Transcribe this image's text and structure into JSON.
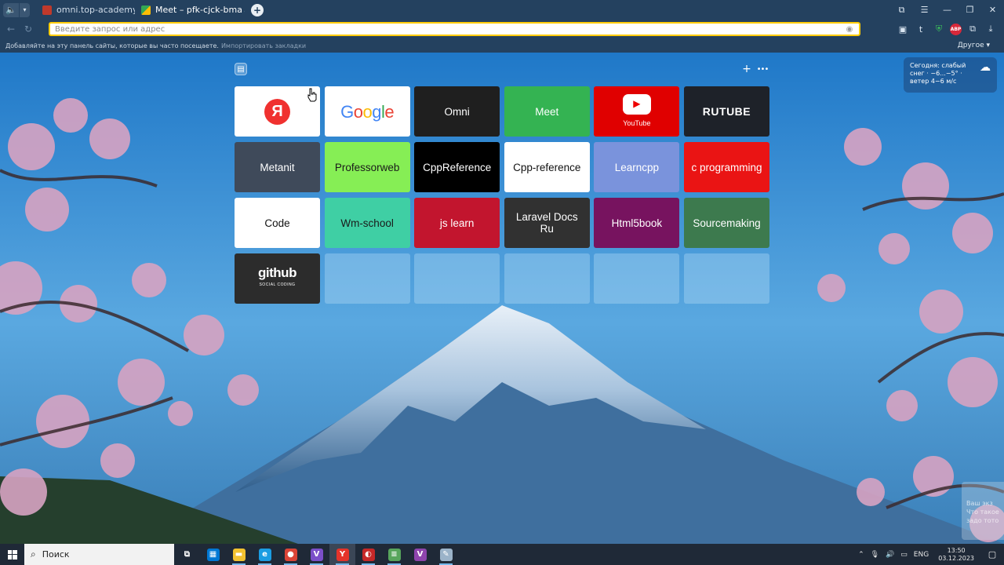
{
  "browser": {
    "tabs": [
      {
        "title": "omni.top-academy.ru/#/p",
        "active": false
      },
      {
        "title": "Meet – pfk-cjck-bma",
        "active": true,
        "audio_icon": "speaker-icon"
      }
    ],
    "new_tab_symbol": "+",
    "address_placeholder": "Введите запрос или адрес",
    "bookmarks_hint": "Добавляйте на эту панель сайты, которые вы часто посещаете.",
    "bookmarks_import": "Импортировать закладки",
    "bookmarks_other": "Другое",
    "extensions": [
      "qr-icon",
      "tumblr-icon",
      "shield-icon",
      "adblock-icon",
      "collections-icon",
      "download-icon"
    ],
    "abp_label": "ABP",
    "tumblr_label": "t"
  },
  "weather": {
    "text": "Сегодня: слабый снег · −6...−5° · ветер 4−6 м/с",
    "icon": "snow-cloud-icon"
  },
  "speed_dial": [
    {
      "name": "yandex",
      "label": "",
      "logo": "Я",
      "bg": "#ffffff",
      "fg": "#000000"
    },
    {
      "name": "google",
      "label": "Google",
      "bg": "#ffffff",
      "fg": "#4285f4"
    },
    {
      "name": "omni",
      "label": "Omni",
      "bg": "#1f1f1f",
      "fg": "#ffffff"
    },
    {
      "name": "meet",
      "label": "Meet",
      "bg": "#34b352",
      "fg": "#ffffff"
    },
    {
      "name": "youtube",
      "label": "YouTube",
      "bg": "#e00000",
      "fg": "#ffffff"
    },
    {
      "name": "rutube",
      "label": "RUTUBE",
      "bg": "#1e2229",
      "fg": "#ffffff"
    },
    {
      "name": "metanit",
      "label": "Metanit",
      "bg": "#3f4a5a",
      "fg": "#ffffff"
    },
    {
      "name": "professorweb",
      "label": "Professorweb",
      "bg": "#86ee55",
      "fg": "#1a1a1a"
    },
    {
      "name": "cppreference",
      "label": "CppReference",
      "bg": "#000000",
      "fg": "#ffffff"
    },
    {
      "name": "cpp-reference",
      "label": "Cpp-reference",
      "bg": "#ffffff",
      "fg": "#111111"
    },
    {
      "name": "learncpp",
      "label": "Learncpp",
      "bg": "#7a93dc",
      "fg": "#ffffff"
    },
    {
      "name": "c-programming",
      "label": "c programming",
      "bg": "#ea1414",
      "fg": "#ffffff"
    },
    {
      "name": "code",
      "label": "Code",
      "bg": "#ffffff",
      "fg": "#111111"
    },
    {
      "name": "wm-school",
      "label": "Wm-school",
      "bg": "#3fcfa4",
      "fg": "#1a1a1a"
    },
    {
      "name": "js-learn",
      "label": "js learn",
      "bg": "#c2152e",
      "fg": "#ffffff"
    },
    {
      "name": "laravel-docs",
      "label": "Laravel Docs Ru",
      "bg": "#313131",
      "fg": "#ffffff"
    },
    {
      "name": "html5book",
      "label": "Html5book",
      "bg": "#77135f",
      "fg": "#ffffff"
    },
    {
      "name": "sourcemaking",
      "label": "Sourcemaking",
      "bg": "#3d7a4e",
      "fg": "#ffffff"
    },
    {
      "name": "github",
      "label": "github",
      "sub": "SOCIAL CODING",
      "bg": "#2c2c2c",
      "fg": "#ffffff"
    },
    {
      "name": "empty-1",
      "label": "",
      "empty": true
    },
    {
      "name": "empty-2",
      "label": "",
      "empty": true
    },
    {
      "name": "empty-3",
      "label": "",
      "empty": true
    },
    {
      "name": "empty-4",
      "label": "",
      "empty": true
    },
    {
      "name": "empty-5",
      "label": "",
      "empty": true
    }
  ],
  "taskbar": {
    "search_placeholder": "Поиск",
    "apps": [
      {
        "name": "task-view-icon",
        "glyph": "⧉",
        "bg": "transparent"
      },
      {
        "name": "store-icon",
        "glyph": "▦",
        "bg": "#0078d4"
      },
      {
        "name": "file-explorer-icon",
        "glyph": "▬",
        "bg": "#f2c230"
      },
      {
        "name": "edge-icon",
        "glyph": "e",
        "bg": "#1b9de2"
      },
      {
        "name": "chrome-icon",
        "glyph": "●",
        "bg": "#db4437"
      },
      {
        "name": "visual-studio-icon",
        "glyph": "V",
        "bg": "#7b4fc9"
      },
      {
        "name": "yandex-browser-icon",
        "glyph": "Y",
        "bg": "#e5332a"
      },
      {
        "name": "music-app-icon",
        "glyph": "◐",
        "bg": "#c62828"
      },
      {
        "name": "notepad-icon",
        "glyph": "≡",
        "bg": "#58a55c"
      },
      {
        "name": "visual-studio-2-icon",
        "glyph": "V",
        "bg": "#8e44ad"
      },
      {
        "name": "paint-icon",
        "glyph": "✎",
        "bg": "#9bb3c9"
      }
    ],
    "lang": "ENG",
    "time": "13:50",
    "date": "03.12.2023"
  },
  "toast": {
    "line1": "Ваш экз",
    "line2": "Что такое",
    "line3": "задо тото"
  }
}
